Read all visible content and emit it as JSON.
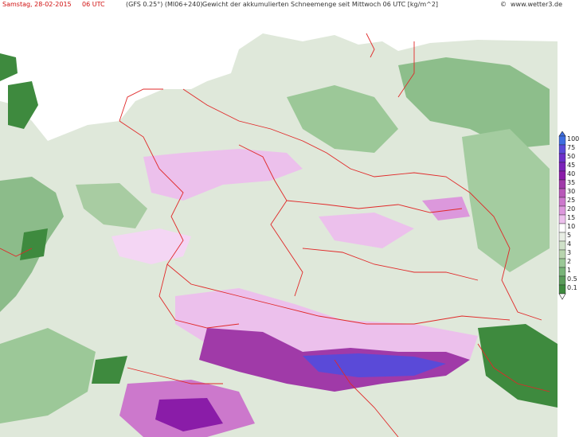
{
  "header": {
    "date": "Samstag, 28-02-2015",
    "time": "06 UTC",
    "model": "(GFS 0.25°) (MI06+240)",
    "title": "Gewicht der akkumulierten Schneemenge seit Mittwoch 06 UTC [kg/m^2]",
    "copyright": "©",
    "site": "www.wetter3.de"
  },
  "legend": {
    "levels": [
      "100",
      "75",
      "50",
      "45",
      "40",
      "35",
      "30",
      "25",
      "20",
      "15",
      "10",
      "5",
      "4",
      "3",
      "2",
      "1",
      "0.5",
      "0.1"
    ],
    "colors": [
      "#3e6ee0",
      "#5a4ad8",
      "#6c2fc8",
      "#7a22b8",
      "#8a1ca8",
      "#a03aa8",
      "#b858b8",
      "#cc78cc",
      "#dc98dc",
      "#ecc0ec",
      "#ffffff",
      "#e8eee4",
      "#cfe0c8",
      "#b8d4ae",
      "#9ac896",
      "#78b478",
      "#5a9c5a",
      "#3e8a3e"
    ]
  },
  "colors": {
    "land_high": "#e6eae2",
    "land_low": "#86b486",
    "sea": "#ffffff",
    "border": "#e02828",
    "values_text": "#3030c8",
    "snow_heavy": "#5a4ad8",
    "snow_moderate": "#dc98dc",
    "green_patch": "#3e8a3e"
  }
}
